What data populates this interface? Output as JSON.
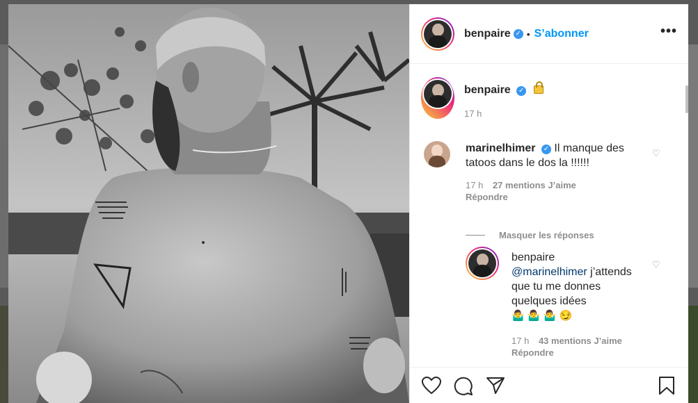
{
  "post": {
    "author": "benpaire",
    "follow_label": "S’abonner",
    "more_label": "•••",
    "separator": "•"
  },
  "caption": {
    "author": "benpaire",
    "time": "17 h"
  },
  "comments": [
    {
      "author": "marinelhimer",
      "text": "Il manque des tatoos dans le dos la !!!!!!",
      "time": "17 h",
      "likes": "27 mentions J’aime",
      "reply_label": "Répondre"
    }
  ],
  "hide_replies_label": "Masquer les réponses",
  "reply": {
    "author": "benpaire",
    "mention": "@marinelhimer",
    "text": "j’attends que tu me donnes quelques idées",
    "emojis": "🤷‍♂️ 🤷‍♂️ 🤷‍♂️ 😏",
    "time": "17 h",
    "likes": "43 mentions J’aime",
    "reply_label": "Répondre"
  },
  "icons": [
    "heart-icon",
    "comment-icon",
    "share-icon",
    "bookmark-icon",
    "verified-icon",
    "lock-icon"
  ],
  "colors": {
    "accent": "#0095f6",
    "verified": "#3897f0",
    "muted": "#8e8e8e",
    "text": "#262626"
  }
}
